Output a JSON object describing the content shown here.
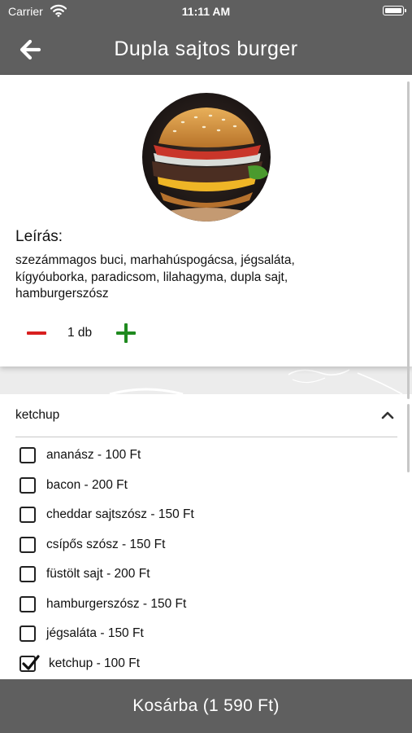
{
  "status_bar": {
    "carrier": "Carrier",
    "time": "11:11 AM"
  },
  "nav": {
    "title": "Dupla sajtos burger"
  },
  "product": {
    "description_heading": "Leírás:",
    "description": "szezámmagos buci, marhahúspogácsa, jégsaláta, kígyóuborka, paradicsom, lilahagyma, dupla sajt, hamburgerszósz",
    "quantity_label": "1 db"
  },
  "options": {
    "header_label": "ketchup",
    "items": [
      {
        "label": "ananász - 100 Ft",
        "checked": false
      },
      {
        "label": "bacon - 200 Ft",
        "checked": false
      },
      {
        "label": "cheddar sajtszósz - 150 Ft",
        "checked": false
      },
      {
        "label": "csípős szósz - 150 Ft",
        "checked": false
      },
      {
        "label": "füstölt sajt - 200 Ft",
        "checked": false
      },
      {
        "label": "hamburgerszósz - 150 Ft",
        "checked": false
      },
      {
        "label": "jégsaláta - 150 Ft",
        "checked": false
      },
      {
        "label": "ketchup - 100 Ft",
        "checked": true
      }
    ]
  },
  "cart": {
    "button_label": "Kosárba (1 590 Ft)"
  },
  "colors": {
    "bar": "#5f5f5f",
    "minus": "#d81f1f",
    "plus": "#1f8a1f"
  },
  "icons": {
    "back": "arrow-left-icon",
    "collapse": "chevron-up-icon",
    "checked": "check-icon",
    "wifi": "wifi-icon",
    "battery": "battery-icon"
  }
}
